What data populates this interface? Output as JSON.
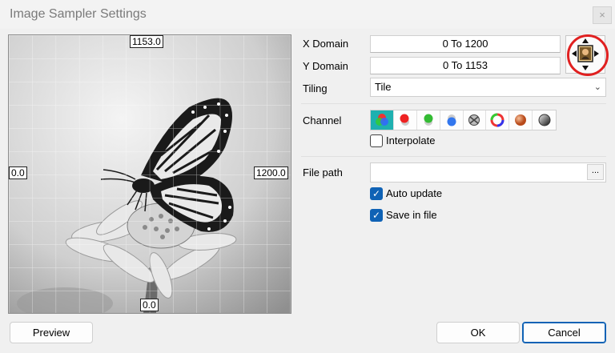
{
  "window": {
    "title": "Image Sampler Settings",
    "close_glyph": "×"
  },
  "preview": {
    "label_top": "1153.0",
    "label_bottom": "0.0",
    "label_left": "0.0",
    "label_right": "1200.0",
    "image": "butterfly-on-flower-grayscale"
  },
  "settings": {
    "x_domain_label": "X Domain",
    "x_domain_value": "0 To 1200",
    "y_domain_label": "Y Domain",
    "y_domain_value": "0 To 1153",
    "tiling_label": "Tiling",
    "tiling_value": "Tile",
    "channel_label": "Channel",
    "channels": [
      {
        "icon": "rgb-channel-icon",
        "active": true
      },
      {
        "icon": "red-channel-icon",
        "active": false
      },
      {
        "icon": "green-channel-icon",
        "active": false
      },
      {
        "icon": "blue-channel-icon",
        "active": false
      },
      {
        "icon": "alpha-channel-icon",
        "active": false
      },
      {
        "icon": "hue-channel-icon",
        "active": false
      },
      {
        "icon": "saturation-channel-icon",
        "active": false
      },
      {
        "icon": "brightness-channel-icon",
        "active": false
      }
    ],
    "interpolate_label": "Interpolate",
    "interpolate_checked": false,
    "file_path_label": "File path",
    "file_path_value": "",
    "browse_label": "...",
    "auto_update_label": "Auto update",
    "auto_update_checked": true,
    "save_in_file_label": "Save in file",
    "save_in_file_checked": true
  },
  "buttons": {
    "preview": "Preview",
    "ok": "OK",
    "cancel": "Cancel"
  },
  "colors": {
    "accent": "#1eb0b0",
    "checkbox": "#0f62b5",
    "highlight_circle": "#e02020"
  }
}
